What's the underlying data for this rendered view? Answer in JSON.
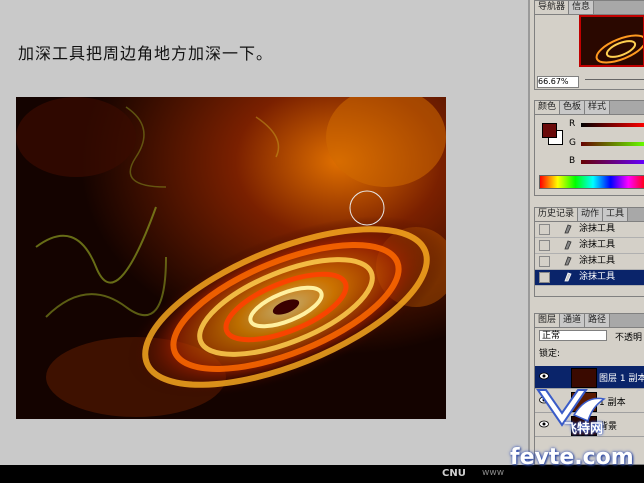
{
  "instruction": "加深工具把周边角地方加深一下。",
  "navigator": {
    "tabs": [
      "导航器",
      "信息"
    ],
    "zoom": "66.67%"
  },
  "color_panel": {
    "tabs": [
      "颜色",
      "色板",
      "样式"
    ],
    "channels": [
      "R",
      "G",
      "B"
    ],
    "foreground": "#6a0a0a",
    "background": "#ffffff"
  },
  "history_panel": {
    "tabs": [
      "历史记录",
      "动作",
      "工具"
    ],
    "items": [
      "涂抹工具",
      "涂抹工具",
      "涂抹工具",
      "涂抹工具"
    ],
    "selected_index": 3
  },
  "layers_panel": {
    "tabs": [
      "图层",
      "通道",
      "路径"
    ],
    "blend_mode": "正常",
    "opacity_label": "不透明",
    "lock_label": "锁定:",
    "layers": [
      {
        "name": "图层 1 副本",
        "selected": true
      },
      {
        "name": "1 副本",
        "selected": false
      },
      {
        "name": "背景",
        "selected": false
      }
    ]
  },
  "footer": {
    "brand": "CNU",
    "url": "www"
  },
  "watermark": {
    "text": "飞特网",
    "url": "fevte.com"
  },
  "colors": {
    "accent": "#0a246a",
    "panel": "#d4d0c8"
  }
}
